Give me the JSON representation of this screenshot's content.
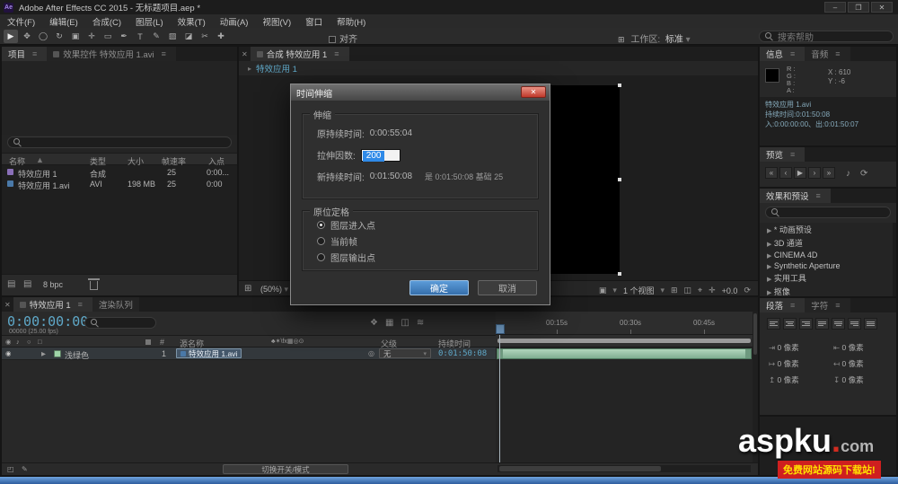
{
  "icons": {
    "hamburger": "≡",
    "close": "✕",
    "caret_down": "▾",
    "twirl_right": "▶",
    "eye": "◉",
    "audio_note": "♪",
    "solo": "○",
    "lock": "□",
    "sort_asc": "▲",
    "pickwhip": "◎",
    "comp": "▦",
    "footage": "▤",
    "folder": "▤",
    "grid": "⊞",
    "camera": "▣",
    "target": "⌖",
    "plus": "✛",
    "snapshot": "◫",
    "flowchart": "❖",
    "wave": "≋",
    "first_frame": "«",
    "prev_frame": "‹",
    "play": "▶",
    "next_frame": "›",
    "last_frame": "»",
    "loop": "⟳",
    "pencil": "✎",
    "boxes": "◰",
    "breadcrumb_arrow": "▸"
  },
  "colors": {
    "accent_cyan": "#5fa8c8",
    "selection_blue": "#2f8ae8",
    "ok_blue": "#3d7fc1",
    "label_green": "#9fd4a8",
    "tagline_red": "#cf1f1f",
    "tagline_yellow": "#ffe000"
  },
  "window": {
    "app_icon": "Ae",
    "title": "Adobe After Effects CC 2015 - 无标题项目.aep *",
    "controls": {
      "minimize": "–",
      "maximize": "❐",
      "close": "✕"
    }
  },
  "menu": {
    "items": [
      "文件(F)",
      "编辑(E)",
      "合成(C)",
      "图层(L)",
      "效果(T)",
      "动画(A)",
      "视图(V)",
      "窗口",
      "帮助(H)"
    ]
  },
  "toolbar": {
    "tools": [
      {
        "name": "selection-tool",
        "glyph": "▶"
      },
      {
        "name": "hand-tool",
        "glyph": "✥"
      },
      {
        "name": "zoom-tool",
        "glyph": "◯"
      },
      {
        "name": "orbit-camera-tool",
        "glyph": "↻"
      },
      {
        "name": "camera-tool",
        "glyph": "▣"
      },
      {
        "name": "pan-behind-tool",
        "glyph": "✛"
      },
      {
        "name": "shape-tool",
        "glyph": "▭"
      },
      {
        "name": "pen-tool",
        "glyph": "✒"
      },
      {
        "name": "text-tool",
        "glyph": "T"
      },
      {
        "name": "brush-tool",
        "glyph": "✎"
      },
      {
        "name": "clone-stamp-tool",
        "glyph": "▨"
      },
      {
        "name": "eraser-tool",
        "glyph": "◪"
      },
      {
        "name": "roto-brush-tool",
        "glyph": "✂"
      },
      {
        "name": "puppet-pin-tool",
        "glyph": "✚"
      }
    ],
    "snap_label": "对齐",
    "workspace_label": "工作区:",
    "workspace_value": "标准",
    "search_placeholder": "搜索帮助"
  },
  "project": {
    "tabs": [
      {
        "label": "项目"
      },
      {
        "label": "效果控件 特效应用 1.avi"
      }
    ],
    "columns": [
      "名称",
      "类型",
      "大小",
      "帧速率",
      "入点"
    ],
    "rows": [
      {
        "name": "特效应用 1",
        "type": "合成",
        "size": "",
        "fps": "25",
        "in_point": "0:00..."
      },
      {
        "name": "特效应用 1.avi",
        "type": "AVI",
        "size": "198 MB",
        "fps": "25",
        "in_point": "0:00"
      }
    ],
    "color_depth": "8 bpc"
  },
  "viewer": {
    "tab": "合成 特效应用 1",
    "breadcrumb": "特效应用 1",
    "zoom": "(50%)",
    "views": "1 个视图",
    "exposure": "+0.0"
  },
  "info": {
    "tabs": [
      "信息",
      "音频"
    ],
    "channels": [
      "R :",
      "G :",
      "B :",
      "A :"
    ],
    "x_readout": "X : 610",
    "y_readout": "Y : -6",
    "clip_name": "特效应用 1.avi",
    "duration_line": "持续时间:0:01:50:08",
    "inout_line": "入:0:00:00:00、出:0:01:50:07"
  },
  "preview_panel": {
    "tab": "预览"
  },
  "effects": {
    "tab": "效果和预设",
    "items": [
      "* 动画预设",
      "3D 通道",
      "CINEMA 4D",
      "Synthetic Aperture",
      "实用工具",
      "抠像"
    ]
  },
  "paragraph": {
    "tabs": [
      "段落",
      "字符"
    ],
    "indent_icons": [
      "⇥",
      "⇤",
      "↦",
      "↤",
      "↥",
      "↧"
    ],
    "fields": [
      "0 像素",
      "0 像素",
      "0 像素",
      "0 像素",
      "0 像素",
      "0 像素"
    ]
  },
  "timeline": {
    "tabs": [
      {
        "label": "特效应用 1"
      },
      {
        "label": "渲染队列"
      }
    ],
    "timecode": "0:00:00:00",
    "frame_info": "00000 (25.00 fps)",
    "columns": {
      "number": "#",
      "source": "源名称",
      "switches": "♣✶\\fx▦◎⊙",
      "parent": "父级",
      "duration": "持续时间"
    },
    "layer": {
      "number": "1",
      "label_color": "浅绿色",
      "source": "特效应用 1.avi",
      "parent": "无",
      "duration": "0:01:50:08"
    },
    "ruler": [
      "00:15s",
      "00:30s",
      "00:45s"
    ],
    "toggle_label": "切换开关/模式"
  },
  "dialog": {
    "title": "时间伸缩",
    "stretch_legend": "伸缩",
    "orig_label": "原持续时间:",
    "orig_value": "0:00:55:04",
    "factor_label": "拉伸因数:",
    "factor_value": "200",
    "new_label": "新持续时间:",
    "new_value": "0:01:50:08",
    "new_note": "是 0:01:50:08 基础 25",
    "hold_legend": "原位定格",
    "options": [
      {
        "label": "图层进入点",
        "selected": true
      },
      {
        "label": "当前帧",
        "selected": false
      },
      {
        "label": "图层输出点",
        "selected": false
      }
    ],
    "ok_label": "确定",
    "cancel_label": "取消"
  },
  "watermark": {
    "brand": "aspku",
    "dot": ".",
    "tld": "com",
    "tagline": "免费网站源码下载站!"
  }
}
